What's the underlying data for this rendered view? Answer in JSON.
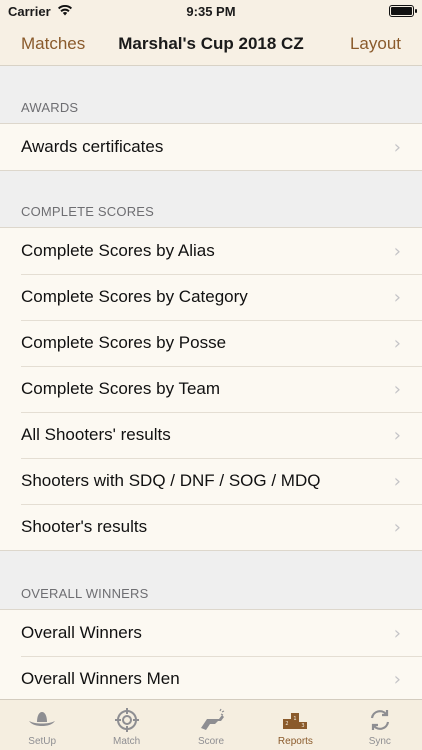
{
  "status_bar": {
    "carrier": "Carrier",
    "time": "9:35 PM"
  },
  "nav": {
    "left": "Matches",
    "title": "Marshal's Cup 2018 CZ",
    "right": "Layout"
  },
  "sections": [
    {
      "header": "AWARDS",
      "items": [
        "Awards certificates"
      ]
    },
    {
      "header": "COMPLETE SCORES",
      "items": [
        "Complete Scores by Alias",
        "Complete Scores by Category",
        "Complete Scores by Posse",
        "Complete Scores by Team",
        "All Shooters' results",
        "Shooters with SDQ / DNF / SOG / MDQ",
        "Shooter's results"
      ]
    },
    {
      "header": "OVERALL WINNERS",
      "items": [
        "Overall Winners",
        "Overall Winners Men"
      ]
    }
  ],
  "tabs": [
    {
      "label": "SetUp",
      "icon": "cowboy-hat-icon"
    },
    {
      "label": "Match",
      "icon": "crosshair-icon"
    },
    {
      "label": "Score",
      "icon": "revolver-icon"
    },
    {
      "label": "Reports",
      "icon": "podium-icon",
      "active": true
    },
    {
      "label": "Sync",
      "icon": "sync-icon"
    }
  ],
  "colors": {
    "accent": "#8a5a2b",
    "bar_bg": "#f7f0e4",
    "row_bg": "#fcf9f2"
  }
}
